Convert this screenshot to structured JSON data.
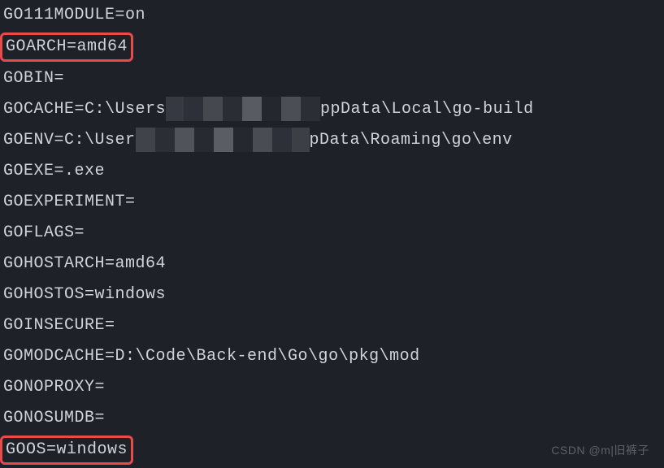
{
  "env": {
    "go111module": "GO111MODULE=on",
    "goarch": "GOARCH=amd64",
    "gobin": "GOBIN=",
    "gocache_pre": "GOCACHE=C:\\Users",
    "gocache_post": "ppData\\Local\\go-build",
    "goenv_pre": "GOENV=C:\\User",
    "goenv_post": "pData\\Roaming\\go\\env",
    "goexe": "GOEXE=.exe",
    "goexperiment": "GOEXPERIMENT=",
    "goflags": "GOFLAGS=",
    "gohostarch": "GOHOSTARCH=amd64",
    "gohostos": "GOHOSTOS=windows",
    "goinsecure": "GOINSECURE=",
    "gomodcache": "GOMODCACHE=D:\\Code\\Back-end\\Go\\go\\pkg\\mod",
    "gonoproxy": "GONOPROXY=",
    "gonosumdb": "GONOSUMDB=",
    "goos": "GOOS=windows"
  },
  "watermark": "CSDN @m|旧裤子"
}
